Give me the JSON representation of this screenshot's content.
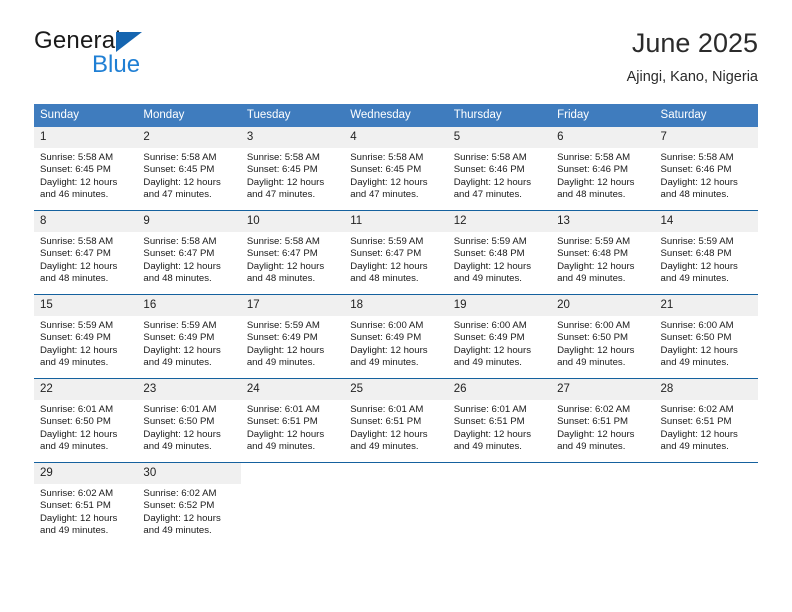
{
  "brand": {
    "name_top": "General",
    "name_bottom": "Blue"
  },
  "header": {
    "title": "June 2025",
    "subtitle": "Ajingi, Kano, Nigeria"
  },
  "colors": {
    "header_blue": "#3f7cbe",
    "rule_blue": "#15619e",
    "daynum_band": "#f0f0f0",
    "brand_blue": "#1f7fd4",
    "triangle_blue": "#1565b0"
  },
  "weekdays": [
    "Sunday",
    "Monday",
    "Tuesday",
    "Wednesday",
    "Thursday",
    "Friday",
    "Saturday"
  ],
  "labels": {
    "sunrise_prefix": "Sunrise:",
    "sunset_prefix": "Sunset:",
    "daylight_prefix": "Daylight:"
  },
  "weeks": [
    [
      {
        "day": "1",
        "sunrise": "Sunrise: 5:58 AM",
        "sunset": "Sunset: 6:45 PM",
        "daylight_line1": "Daylight: 12 hours",
        "daylight_line2": "and 46 minutes."
      },
      {
        "day": "2",
        "sunrise": "Sunrise: 5:58 AM",
        "sunset": "Sunset: 6:45 PM",
        "daylight_line1": "Daylight: 12 hours",
        "daylight_line2": "and 47 minutes."
      },
      {
        "day": "3",
        "sunrise": "Sunrise: 5:58 AM",
        "sunset": "Sunset: 6:45 PM",
        "daylight_line1": "Daylight: 12 hours",
        "daylight_line2": "and 47 minutes."
      },
      {
        "day": "4",
        "sunrise": "Sunrise: 5:58 AM",
        "sunset": "Sunset: 6:45 PM",
        "daylight_line1": "Daylight: 12 hours",
        "daylight_line2": "and 47 minutes."
      },
      {
        "day": "5",
        "sunrise": "Sunrise: 5:58 AM",
        "sunset": "Sunset: 6:46 PM",
        "daylight_line1": "Daylight: 12 hours",
        "daylight_line2": "and 47 minutes."
      },
      {
        "day": "6",
        "sunrise": "Sunrise: 5:58 AM",
        "sunset": "Sunset: 6:46 PM",
        "daylight_line1": "Daylight: 12 hours",
        "daylight_line2": "and 48 minutes."
      },
      {
        "day": "7",
        "sunrise": "Sunrise: 5:58 AM",
        "sunset": "Sunset: 6:46 PM",
        "daylight_line1": "Daylight: 12 hours",
        "daylight_line2": "and 48 minutes."
      }
    ],
    [
      {
        "day": "8",
        "sunrise": "Sunrise: 5:58 AM",
        "sunset": "Sunset: 6:47 PM",
        "daylight_line1": "Daylight: 12 hours",
        "daylight_line2": "and 48 minutes."
      },
      {
        "day": "9",
        "sunrise": "Sunrise: 5:58 AM",
        "sunset": "Sunset: 6:47 PM",
        "daylight_line1": "Daylight: 12 hours",
        "daylight_line2": "and 48 minutes."
      },
      {
        "day": "10",
        "sunrise": "Sunrise: 5:58 AM",
        "sunset": "Sunset: 6:47 PM",
        "daylight_line1": "Daylight: 12 hours",
        "daylight_line2": "and 48 minutes."
      },
      {
        "day": "11",
        "sunrise": "Sunrise: 5:59 AM",
        "sunset": "Sunset: 6:47 PM",
        "daylight_line1": "Daylight: 12 hours",
        "daylight_line2": "and 48 minutes."
      },
      {
        "day": "12",
        "sunrise": "Sunrise: 5:59 AM",
        "sunset": "Sunset: 6:48 PM",
        "daylight_line1": "Daylight: 12 hours",
        "daylight_line2": "and 49 minutes."
      },
      {
        "day": "13",
        "sunrise": "Sunrise: 5:59 AM",
        "sunset": "Sunset: 6:48 PM",
        "daylight_line1": "Daylight: 12 hours",
        "daylight_line2": "and 49 minutes."
      },
      {
        "day": "14",
        "sunrise": "Sunrise: 5:59 AM",
        "sunset": "Sunset: 6:48 PM",
        "daylight_line1": "Daylight: 12 hours",
        "daylight_line2": "and 49 minutes."
      }
    ],
    [
      {
        "day": "15",
        "sunrise": "Sunrise: 5:59 AM",
        "sunset": "Sunset: 6:49 PM",
        "daylight_line1": "Daylight: 12 hours",
        "daylight_line2": "and 49 minutes."
      },
      {
        "day": "16",
        "sunrise": "Sunrise: 5:59 AM",
        "sunset": "Sunset: 6:49 PM",
        "daylight_line1": "Daylight: 12 hours",
        "daylight_line2": "and 49 minutes."
      },
      {
        "day": "17",
        "sunrise": "Sunrise: 5:59 AM",
        "sunset": "Sunset: 6:49 PM",
        "daylight_line1": "Daylight: 12 hours",
        "daylight_line2": "and 49 minutes."
      },
      {
        "day": "18",
        "sunrise": "Sunrise: 6:00 AM",
        "sunset": "Sunset: 6:49 PM",
        "daylight_line1": "Daylight: 12 hours",
        "daylight_line2": "and 49 minutes."
      },
      {
        "day": "19",
        "sunrise": "Sunrise: 6:00 AM",
        "sunset": "Sunset: 6:49 PM",
        "daylight_line1": "Daylight: 12 hours",
        "daylight_line2": "and 49 minutes."
      },
      {
        "day": "20",
        "sunrise": "Sunrise: 6:00 AM",
        "sunset": "Sunset: 6:50 PM",
        "daylight_line1": "Daylight: 12 hours",
        "daylight_line2": "and 49 minutes."
      },
      {
        "day": "21",
        "sunrise": "Sunrise: 6:00 AM",
        "sunset": "Sunset: 6:50 PM",
        "daylight_line1": "Daylight: 12 hours",
        "daylight_line2": "and 49 minutes."
      }
    ],
    [
      {
        "day": "22",
        "sunrise": "Sunrise: 6:01 AM",
        "sunset": "Sunset: 6:50 PM",
        "daylight_line1": "Daylight: 12 hours",
        "daylight_line2": "and 49 minutes."
      },
      {
        "day": "23",
        "sunrise": "Sunrise: 6:01 AM",
        "sunset": "Sunset: 6:50 PM",
        "daylight_line1": "Daylight: 12 hours",
        "daylight_line2": "and 49 minutes."
      },
      {
        "day": "24",
        "sunrise": "Sunrise: 6:01 AM",
        "sunset": "Sunset: 6:51 PM",
        "daylight_line1": "Daylight: 12 hours",
        "daylight_line2": "and 49 minutes."
      },
      {
        "day": "25",
        "sunrise": "Sunrise: 6:01 AM",
        "sunset": "Sunset: 6:51 PM",
        "daylight_line1": "Daylight: 12 hours",
        "daylight_line2": "and 49 minutes."
      },
      {
        "day": "26",
        "sunrise": "Sunrise: 6:01 AM",
        "sunset": "Sunset: 6:51 PM",
        "daylight_line1": "Daylight: 12 hours",
        "daylight_line2": "and 49 minutes."
      },
      {
        "day": "27",
        "sunrise": "Sunrise: 6:02 AM",
        "sunset": "Sunset: 6:51 PM",
        "daylight_line1": "Daylight: 12 hours",
        "daylight_line2": "and 49 minutes."
      },
      {
        "day": "28",
        "sunrise": "Sunrise: 6:02 AM",
        "sunset": "Sunset: 6:51 PM",
        "daylight_line1": "Daylight: 12 hours",
        "daylight_line2": "and 49 minutes."
      }
    ],
    [
      {
        "day": "29",
        "sunrise": "Sunrise: 6:02 AM",
        "sunset": "Sunset: 6:51 PM",
        "daylight_line1": "Daylight: 12 hours",
        "daylight_line2": "and 49 minutes."
      },
      {
        "day": "30",
        "sunrise": "Sunrise: 6:02 AM",
        "sunset": "Sunset: 6:52 PM",
        "daylight_line1": "Daylight: 12 hours",
        "daylight_line2": "and 49 minutes."
      },
      {
        "day": "",
        "sunrise": "",
        "sunset": "",
        "daylight_line1": "",
        "daylight_line2": ""
      },
      {
        "day": "",
        "sunrise": "",
        "sunset": "",
        "daylight_line1": "",
        "daylight_line2": ""
      },
      {
        "day": "",
        "sunrise": "",
        "sunset": "",
        "daylight_line1": "",
        "daylight_line2": ""
      },
      {
        "day": "",
        "sunrise": "",
        "sunset": "",
        "daylight_line1": "",
        "daylight_line2": ""
      },
      {
        "day": "",
        "sunrise": "",
        "sunset": "",
        "daylight_line1": "",
        "daylight_line2": ""
      }
    ]
  ]
}
